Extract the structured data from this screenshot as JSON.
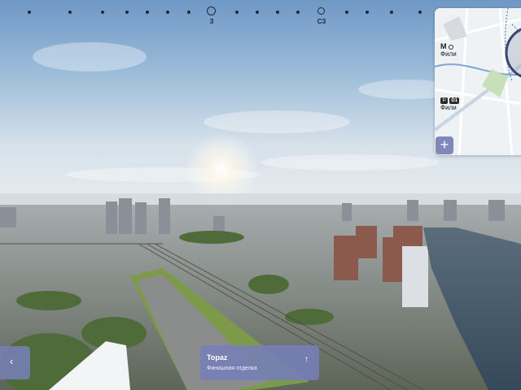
{
  "compass": {
    "labels": {
      "west": "З",
      "northwest": "СЗ"
    }
  },
  "map": {
    "stations": [
      {
        "icon": "metro-icon",
        "name": "Фили"
      },
      {
        "icon": "rail-icon",
        "badge": "D1",
        "name": "Фили"
      }
    ],
    "zoom_in_label": "+"
  },
  "building_card": {
    "title": "Topaz",
    "subtitle": "Финишная отделка",
    "arrow": "↑"
  },
  "left_card": {
    "arrow": "‹"
  },
  "colors": {
    "card_bg": "#7680b6",
    "sky_top": "#6f98c6",
    "river": "#3b4f62"
  }
}
